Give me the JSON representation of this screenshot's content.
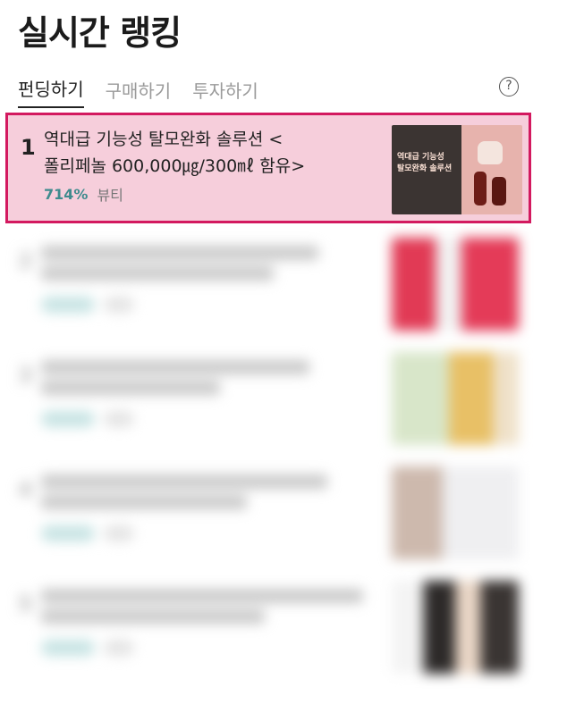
{
  "page": {
    "title": "실시간 랭킹"
  },
  "tabs": [
    {
      "label": "펀딩하기",
      "active": true
    },
    {
      "label": "구매하기",
      "active": false
    },
    {
      "label": "투자하기",
      "active": false
    }
  ],
  "help_icon": "question-circle-icon",
  "items": [
    {
      "rank": "1",
      "title_line1": "역대급 기능성 탈모완화 솔루션 <",
      "title_line2": "폴리페놀 600,000㎍/300㎖ 함유>",
      "rate": "714%",
      "category": "뷰티",
      "thumb": {
        "headline_line1": "역대급 기능성",
        "headline_line2": "탈모완화 솔루션"
      }
    }
  ],
  "colors": {
    "highlight_bg": "#f6cedb",
    "highlight_border": "#d3195f",
    "rate": "#3f8b8e"
  }
}
